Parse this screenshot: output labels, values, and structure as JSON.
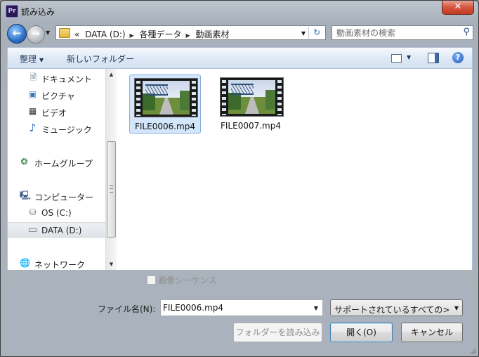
{
  "window": {
    "title": "読み込み",
    "app_icon": "Pr",
    "close_glyph": "✕"
  },
  "nav": {
    "back_glyph": "←",
    "forward_glyph": "→",
    "history_glyph": "▼",
    "breadcrumb_prefix": "«",
    "breadcrumb": [
      "DATA (D:)",
      "各種データ",
      "動画素材"
    ],
    "breadcrumb_separator": "▶",
    "address_dropdown_glyph": "▼",
    "refresh_glyph": "↻",
    "search_placeholder": "動画素材の検索",
    "search_glyph": "⚲"
  },
  "toolbar": {
    "organize_label": "整理",
    "organize_arrow": "▼",
    "new_folder_label": "新しいフォルダー",
    "view_arrow": "▼",
    "help_glyph": "?"
  },
  "sidebar": {
    "items": [
      {
        "label": "ドキュメント",
        "icon": "document-icon",
        "glyph": "🗎"
      },
      {
        "label": "ピクチャ",
        "icon": "pictures-icon",
        "glyph": "▣"
      },
      {
        "label": "ビデオ",
        "icon": "video-icon",
        "glyph": "▦"
      },
      {
        "label": "ミュージック",
        "icon": "music-icon",
        "glyph": "♪"
      },
      {
        "label": "ホームグループ",
        "icon": "homegroup-icon",
        "glyph": "❂"
      },
      {
        "label": "コンピューター",
        "icon": "computer-icon",
        "glyph": "🖳"
      },
      {
        "label": "OS (C:)",
        "icon": "system-drive-icon",
        "glyph": "⛁"
      },
      {
        "label": "DATA (D:)",
        "icon": "drive-icon",
        "glyph": "▭"
      },
      {
        "label": "ネットワーク",
        "icon": "network-icon",
        "glyph": "🌐"
      }
    ],
    "scroll_up_glyph": "▲",
    "scroll_down_glyph": "▼"
  },
  "files": [
    {
      "name": "FILE0006.mp4",
      "selected": true
    },
    {
      "name": "FILE0007.mp4",
      "selected": false
    }
  ],
  "options": {
    "image_sequence_label": "画像シーケンス"
  },
  "footer": {
    "filename_label": "ファイル名(N):",
    "filename_value": "FILE0006.mp4",
    "filename_dropdown_glyph": "▼",
    "filter_value": "サポートされているすべての>",
    "filter_dropdown_glyph": "▼",
    "import_folder_label": "フォルダーを読み込み",
    "open_label": "開く(O)",
    "cancel_label": "キャンセル"
  },
  "colors": {
    "selection_bg": "#d4e6fb",
    "selection_border": "#84acdd",
    "close_red": "#c23c22",
    "toolbar_text": "#1e395b"
  }
}
